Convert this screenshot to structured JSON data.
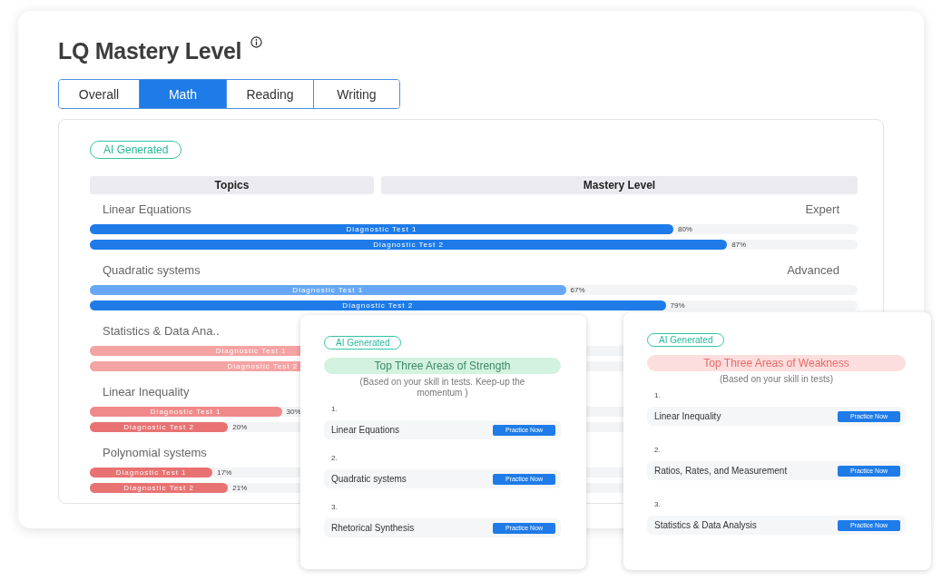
{
  "title": "LQ Mastery Level",
  "tabs": [
    {
      "label": "Overall",
      "selected": false
    },
    {
      "label": "Math",
      "selected": true
    },
    {
      "label": "Reading",
      "selected": false
    },
    {
      "label": "Writing",
      "selected": false
    }
  ],
  "panel": {
    "badge": "AI Generated",
    "columns": [
      "Topics",
      "Mastery Level"
    ],
    "topics": [
      {
        "name": "Linear Equations",
        "level_label": "Expert",
        "bars": [
          {
            "label": "Diagnostic Test 1",
            "level": 0.76,
            "reading": "80%",
            "color": "#1e7be8"
          },
          {
            "label": "Diagnostic Test 2",
            "level": 0.83,
            "reading": "87%",
            "color": "#1e7be8"
          }
        ]
      },
      {
        "name": "Quadratic systems",
        "level_label": "Advanced",
        "bars": [
          {
            "label": "Diagnostic Test 1",
            "level": 0.62,
            "reading": "67%",
            "color": "#66a8f5"
          },
          {
            "label": "Diagnostic Test 2",
            "level": 0.75,
            "reading": "79%",
            "color": "#1e7be8"
          }
        ]
      },
      {
        "name": "Statistics & Data Ana..",
        "bars": [
          {
            "label": "Diagnostic Test 1",
            "level": 0.42,
            "color": "#f5a3a3"
          },
          {
            "label": "Diagnostic Test 2",
            "level": 0.45,
            "color": "#f5a3a3"
          }
        ]
      },
      {
        "name": "Linear Inequality",
        "bars": [
          {
            "label": "Diagnostic Test 1",
            "level": 0.25,
            "reading": "30%",
            "color": "#f08a8a"
          },
          {
            "label": "Diagnostic Test 2",
            "level": 0.18,
            "reading": "20%",
            "color": "#e87272"
          }
        ]
      },
      {
        "name": "Polynomial systems",
        "bars": [
          {
            "label": "Diagnostic Test 1",
            "level": 0.16,
            "reading": "17%",
            "color": "#e87272"
          },
          {
            "label": "Diagnostic Test 2",
            "level": 0.18,
            "reading": "21%",
            "color": "#e87272"
          }
        ]
      }
    ]
  },
  "summary_cards": [
    {
      "kind": "strength",
      "badge": "AI Generated",
      "heading": "Top Three Areas of Strength",
      "note": "(Based on your skill in tests. Keep-up the momentum )",
      "items": [
        {
          "number": "1.",
          "name": "Linear Equations",
          "button": "Practice Now"
        },
        {
          "number": "2.",
          "name": "Quadratic systems",
          "button": "Practice Now"
        },
        {
          "number": "3.",
          "name": "Rhetorical Synthesis",
          "button": "Practice Now"
        }
      ]
    },
    {
      "kind": "weakness",
      "badge": "AI Generated",
      "heading": "Top Three Areas of Weakness",
      "note": "(Based on your skill in tests)",
      "items": [
        {
          "number": "1.",
          "name": "Linear Inequality",
          "button": "Practice Now"
        },
        {
          "number": "2.",
          "name": "Ratios, Rates, and Measurement",
          "button": "Practice Now"
        },
        {
          "number": "3.",
          "name": "Statistics & Data Analysis",
          "button": "Practice Now"
        }
      ]
    }
  ]
}
